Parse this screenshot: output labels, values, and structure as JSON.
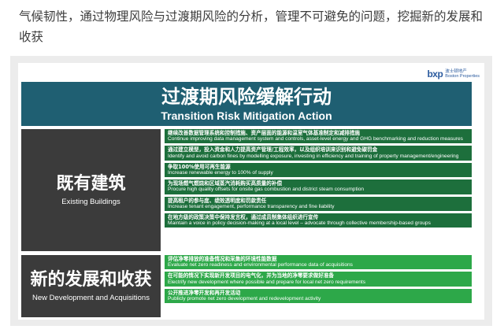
{
  "intro": {
    "text": "气候韧性，通过物理风险与过渡期风险的分析，管理不可避免的问题，挖掘新的发展和收获"
  },
  "logo": {
    "mark": "bxp",
    "cn": "波士顿地产",
    "en": "Boston Properties"
  },
  "slide": {
    "title_cn": "过渡期风险缓解行动",
    "title_en": "Transition Risk Mitigation Action"
  },
  "categories": [
    {
      "cn": "既有建筑",
      "en": "Existing Buildings"
    },
    {
      "cn": "新的发展和收获",
      "en": "New Development and Acquisitions"
    }
  ],
  "existing_actions": [
    {
      "cn": "继续改善数据管理系统和控制措施、资产层面的能源和温室气体基准制定和减排措施",
      "en": "Continue improving data management system and controls, asset-level energy and GHG benchmarking and reduction measures"
    },
    {
      "cn": "通过建立模型，投入资金和人力提高资产管理/工程效率，以及组织培训来识别和避免碳罚金",
      "en": "Identify and avoid carbon fines by modelling exposure, investing in efficiency and training of property management/engineering"
    },
    {
      "cn": "争取100%使用可再生能源",
      "en": "Increase renewable energy to 100% of supply"
    },
    {
      "cn": "为现场燃气燃烧和区域蒸汽消耗购买高质量的补偿",
      "en": "Procure high quality offsets for onsite gas combustion and district steam consumption"
    },
    {
      "cn": "提高租户的参与度、绩效透明度和罚款责任",
      "en": "Increase tenant engagement, performance transparency and fine liability"
    },
    {
      "cn": "在地方级的政策决策中保持发言权，通过成员制集体组织进行宣传",
      "en": "Maintain a voice in policy decision-making at a local level – advocate through collective membership-based groups"
    }
  ],
  "new_actions": [
    {
      "cn": "评估净零排放的准备情况和采集的环境性能数据",
      "en": "Evaluate net zero readiness and environmental performance data of acquisitions"
    },
    {
      "cn": "在可能的情况下实现新开发项目的电气化，并为当地的净零要求做好准备",
      "en": "Electrify new development where possible and prepare for local net zero requirements"
    },
    {
      "cn": "公开推进净零开发和再开发活动",
      "en": "Publicly promote net zero development and redevelopment activity"
    }
  ]
}
